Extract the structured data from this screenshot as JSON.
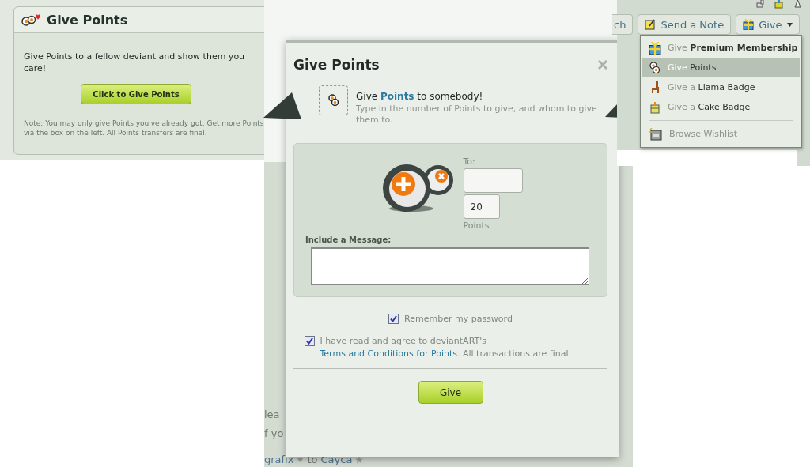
{
  "left_panel": {
    "title": "Give Points",
    "description": "Give Points to a fellow deviant and show them you care!",
    "button": "Click to Give Points",
    "note": "Note: You may only give Points you've already got. Get more Points via the box on the left. All Points transfers are final."
  },
  "background_page": {
    "lines": [
      "lea",
      "f yo"
    ],
    "user_from": "grafix",
    "connector": "to",
    "user_to": "Cayca"
  },
  "dialog": {
    "title": "Give Points",
    "heading_before": "Give",
    "heading_link": "Points",
    "heading_after": "to somebody!",
    "subtext": "Type in the number of Points to give, and whom to give them to.",
    "to_label": "To:",
    "points_value": "20",
    "points_label": "Points",
    "message_label": "Include a Message:",
    "remember": {
      "label": "Remember my password",
      "checked": true
    },
    "agree": {
      "text_before": "I have read and agree to deviantART's",
      "link": "Terms and Conditions for Points",
      "text_after": ". All transactions are final.",
      "checked": true
    },
    "submit": "Give"
  },
  "right_panel": {
    "toolbar": [
      {
        "label": "ch"
      },
      {
        "label": "Send a Note"
      },
      {
        "label": "Give"
      }
    ],
    "menu": [
      {
        "prefix": "Give",
        "label": "Premium Membership",
        "selected": false
      },
      {
        "prefix": "Give",
        "label": "Points",
        "selected": true
      },
      {
        "prefix": "Give a",
        "label": "Llama Badge",
        "selected": false
      },
      {
        "prefix": "Give a",
        "label": "Cake Badge",
        "selected": false
      }
    ],
    "wishlist": "Browse Wishlist"
  }
}
